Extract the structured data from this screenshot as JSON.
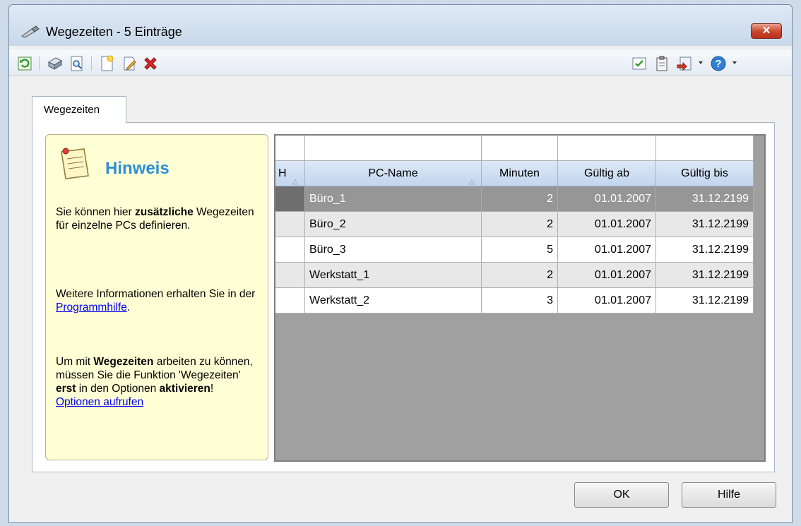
{
  "window": {
    "title": "Wegezeiten - 5 Einträge",
    "close_label": "✕"
  },
  "toolbar": {
    "icons": [
      "refresh-icon",
      "print-icon",
      "print-preview-icon",
      "new-entry-icon",
      "edit-icon",
      "delete-icon",
      "checklist-icon",
      "clipboard-icon",
      "exit-icon",
      "help-icon"
    ]
  },
  "tabs": [
    {
      "label": "Wegezeiten"
    }
  ],
  "hint": {
    "title": "Hinweis",
    "p1_pre": "Sie können hier ",
    "p1_bold": "zusätzliche",
    "p1_post": " Wegezeiten für einzelne PCs definieren.",
    "p2_pre": "Weitere Informationen erhalten Sie in der ",
    "p2_link": "Programmhilfe",
    "p2_post": ".",
    "p3_a": "Um mit ",
    "p3_b": "Wegezeiten",
    "p3_c": " arbeiten zu können, müssen Sie die Funktion 'Wegezeiten' ",
    "p3_d": "erst",
    "p3_e": " in den Optionen ",
    "p3_f": "aktivieren",
    "p3_g": "!",
    "p3_link": "Optionen aufrufen"
  },
  "grid": {
    "columns": [
      "H",
      "PC-Name",
      "Minuten",
      "Gültig ab",
      "Gültig bis"
    ],
    "rows": [
      [
        "",
        "Büro_1",
        "2",
        "01.01.2007",
        "31.12.2199"
      ],
      [
        "",
        "Büro_2",
        "2",
        "01.01.2007",
        "31.12.2199"
      ],
      [
        "",
        "Büro_3",
        "5",
        "01.01.2007",
        "31.12.2199"
      ],
      [
        "",
        "Werkstatt_1",
        "2",
        "01.01.2007",
        "31.12.2199"
      ],
      [
        "",
        "Werkstatt_2",
        "3",
        "01.01.2007",
        "31.12.2199"
      ]
    ]
  },
  "buttons": {
    "ok": "OK",
    "help": "Hilfe"
  }
}
